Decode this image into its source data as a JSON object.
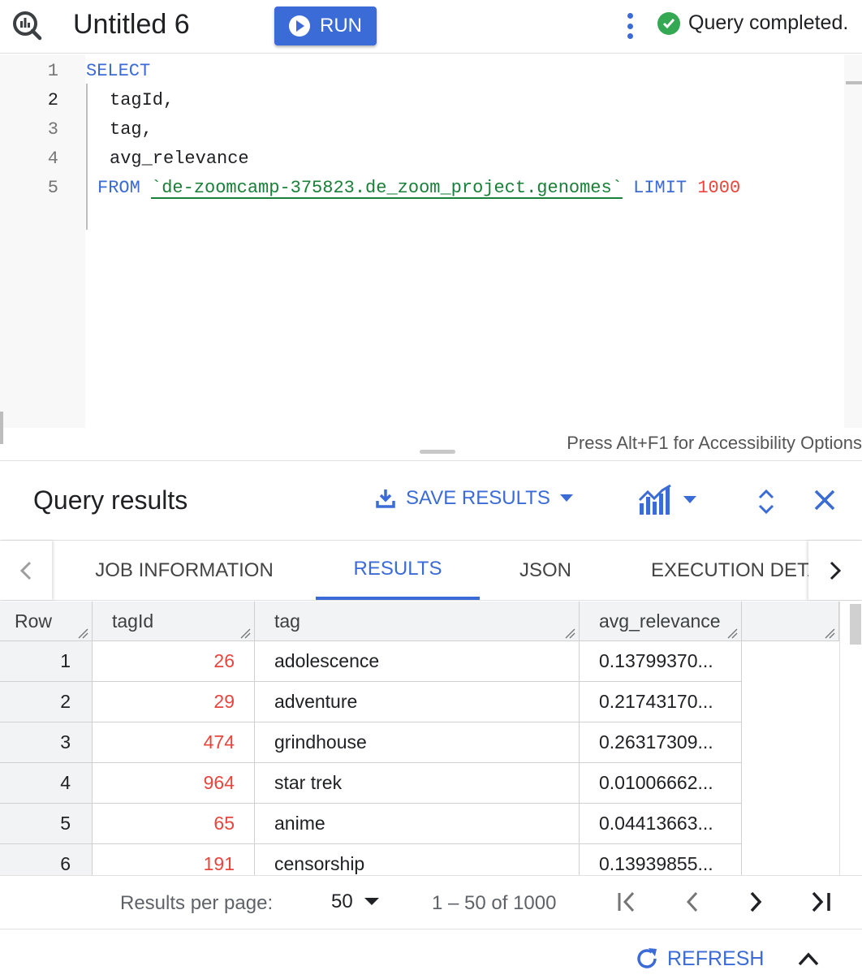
{
  "header": {
    "title": "Untitled 6",
    "run_label": "RUN",
    "status_text": "Query completed."
  },
  "editor": {
    "line_numbers": [
      "1",
      "2",
      "3",
      "4",
      "5"
    ],
    "lines": {
      "l1_kw": "SELECT",
      "l2": "tagId,",
      "l3": "tag,",
      "l4": "avg_relevance",
      "l5_kw_from": "FROM",
      "l5_table": "`de-zoomcamp-375823.de_zoom_project.genomes`",
      "l5_kw_limit": "LIMIT",
      "l5_num": "1000"
    },
    "accessibility_hint": "Press Alt+F1 for Accessibility Options"
  },
  "results": {
    "title": "Query results",
    "save_label": "SAVE RESULTS",
    "tabs": [
      {
        "label": "JOB INFORMATION"
      },
      {
        "label": "RESULTS"
      },
      {
        "label": "JSON"
      },
      {
        "label": "EXECUTION DETAILS"
      }
    ],
    "columns": [
      "Row",
      "tagId",
      "tag",
      "avg_relevance"
    ],
    "rows": [
      {
        "row": "1",
        "tagId": "26",
        "tag": "adolescence",
        "avg_relevance": "0.13799370..."
      },
      {
        "row": "2",
        "tagId": "29",
        "tag": "adventure",
        "avg_relevance": "0.21743170..."
      },
      {
        "row": "3",
        "tagId": "474",
        "tag": "grindhouse",
        "avg_relevance": "0.26317309..."
      },
      {
        "row": "4",
        "tagId": "964",
        "tag": "star trek",
        "avg_relevance": "0.01006662..."
      },
      {
        "row": "5",
        "tagId": "65",
        "tag": "anime",
        "avg_relevance": "0.04413663..."
      },
      {
        "row": "6",
        "tagId": "191",
        "tag": "censorship",
        "avg_relevance": "0.13939855..."
      }
    ]
  },
  "pager": {
    "results_per_page_label": "Results per page:",
    "results_per_page_value": "50",
    "range_text": "1 – 50 of 1000"
  },
  "footer": {
    "refresh_label": "REFRESH"
  },
  "colors": {
    "accent": "#3b6bd6",
    "success": "#34a853",
    "string": "#188038",
    "number": "#e8453c"
  }
}
